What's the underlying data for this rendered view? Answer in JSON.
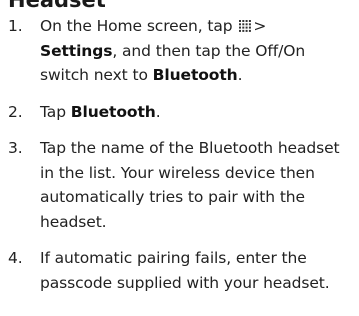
{
  "heading": "Headset",
  "steps": [
    {
      "number": "1.",
      "part_a": "On the Home screen, tap",
      "icon": "apps-grid-icon",
      "arrow": ">",
      "bold_a": "Settings",
      "part_b": ", and then tap the Off/On switch next to",
      "bold_b": "Bluetooth",
      "part_c": "."
    },
    {
      "number": "2.",
      "part_a": "Tap",
      "bold_a": "Bluetooth",
      "part_b": "."
    },
    {
      "number": "3.",
      "text": "Tap the name of the Bluetooth headset in the list. Your wireless device then automatically tries to pair with the headset."
    },
    {
      "number": "4.",
      "text": "If automatic pairing fails, enter the passcode supplied with your headset."
    }
  ]
}
